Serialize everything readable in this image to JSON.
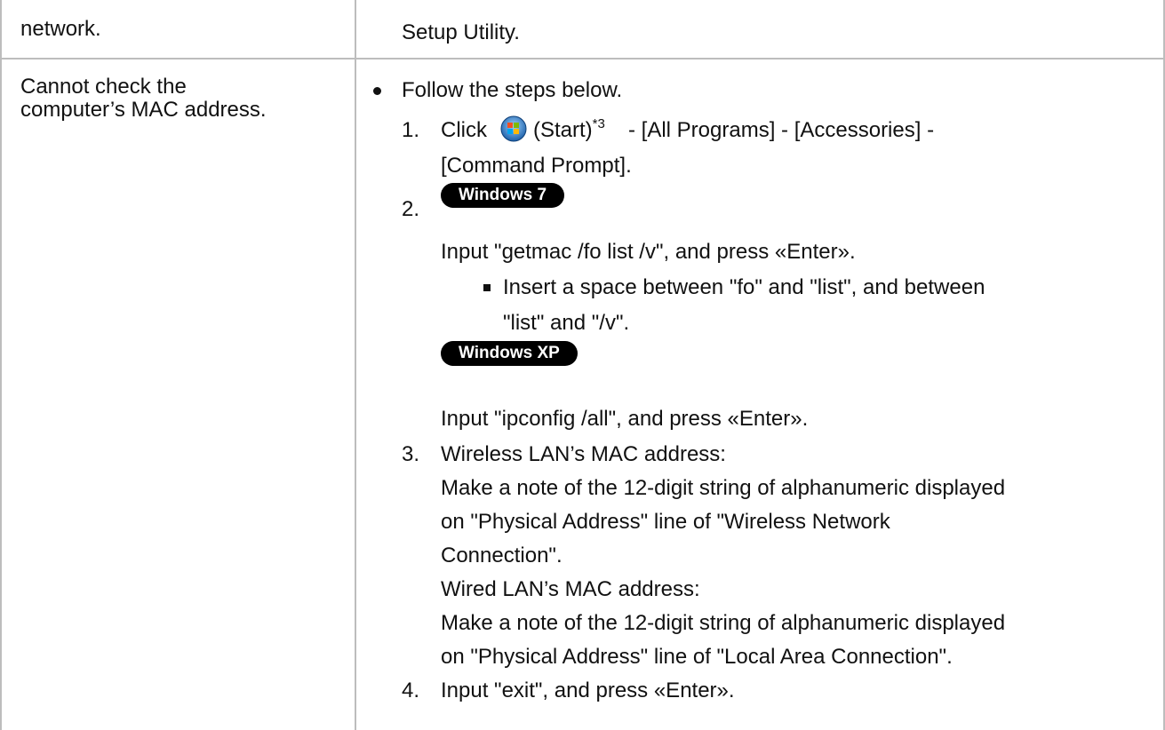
{
  "rows": [
    {
      "left": "network.",
      "right": "Setup Utility."
    },
    {
      "left_line1": "Cannot check the",
      "left_line2": "computer’s MAC address.",
      "bullet": "Follow the steps below.",
      "step1": {
        "num": "1.",
        "pre": "Click",
        "icon": "windows-start-orb-icon",
        "start": "(Start)",
        "footnote": "*3",
        "post": "- [All Programs] - [Accessories] -",
        "line2": "[Command Prompt]."
      },
      "step2": {
        "num": "2.",
        "badge_win7": "Windows 7",
        "win7_input": "Input \"getmac /fo list /v\", and press «Enter».",
        "note_line1": "Insert a space between \"fo\" and \"list\", and between",
        "note_line2": "\"list\" and \"/v\".",
        "badge_winxp": "Windows XP",
        "winxp_input": "Input \"ipconfig /all\", and press «Enter»."
      },
      "step3": {
        "num": "3.",
        "l1": "Wireless LAN’s MAC address:",
        "l2": "Make a note of the 12-digit string of alphanumeric displayed",
        "l3": "on \"Physical Address\" line of \"Wireless Network",
        "l4": "Connection\".",
        "l5": "Wired LAN’s MAC address:",
        "l6": "Make a note of the 12-digit string of alphanumeric displayed",
        "l7": "on \"Physical Address\" line of \"Local Area Connection\"."
      },
      "step4": {
        "num": "4.",
        "text": "Input \"exit\", and press «Enter»."
      }
    }
  ],
  "colors": {
    "border": "#bdbdbd",
    "text": "#111111",
    "badge_bg": "#000000",
    "badge_text": "#ffffff"
  }
}
